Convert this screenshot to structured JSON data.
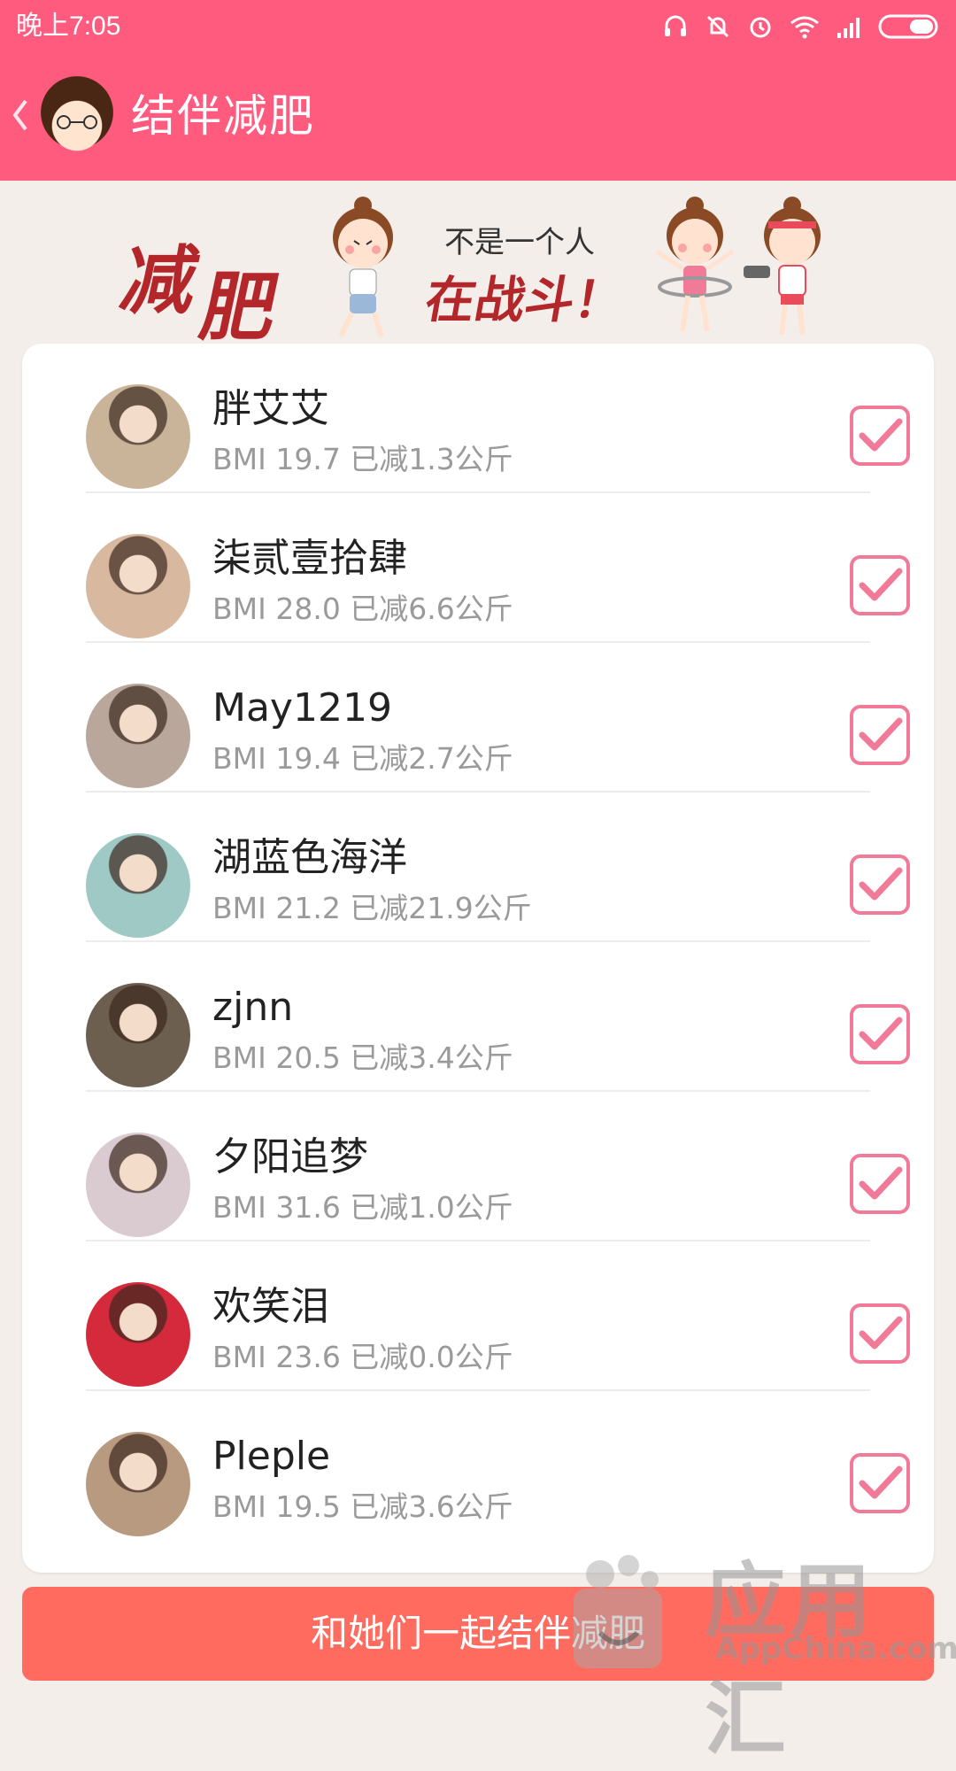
{
  "status_bar": {
    "time": "晚上7:05",
    "icons": [
      "headphones-icon",
      "vibrate-off-icon",
      "alarm-icon",
      "wifi-icon",
      "signal-icon",
      "battery-icon"
    ]
  },
  "app_bar": {
    "title": "结伴减肥",
    "back_icon": "chevron-left-icon"
  },
  "banner": {
    "word1": "减",
    "word2": "肥",
    "line1": "不是一个人",
    "line2": "在战斗！"
  },
  "members": [
    {
      "name": "胖艾艾",
      "stats": "BMI 19.7 已减1.3公斤",
      "checked": true,
      "avatar_color": "#c9b49a"
    },
    {
      "name": "柒贰壹拾肆",
      "stats": "BMI 28.0 已减6.6公斤",
      "checked": true,
      "avatar_color": "#d8b9a0"
    },
    {
      "name": "May1219",
      "stats": "BMI 19.4 已减2.7公斤",
      "checked": true,
      "avatar_color": "#b8a79a"
    },
    {
      "name": "湖蓝色海洋",
      "stats": "BMI 21.2 已减21.9公斤",
      "checked": true,
      "avatar_color": "#9fc9c4"
    },
    {
      "name": "zjnn",
      "stats": "BMI 20.5 已减3.4公斤",
      "checked": true,
      "avatar_color": "#6d5f50"
    },
    {
      "name": "夕阳追梦",
      "stats": "BMI 31.6 已减1.0公斤",
      "checked": true,
      "avatar_color": "#d9cbd0"
    },
    {
      "name": "欢笑泪",
      "stats": "BMI 23.6 已减0.0公斤",
      "checked": true,
      "avatar_color": "#d42a3c"
    },
    {
      "name": "Pleple",
      "stats": "BMI 19.5 已减3.6公斤",
      "checked": true,
      "avatar_color": "#b89a80"
    }
  ],
  "join_button": {
    "label": "和她们一起结伴减肥"
  },
  "watermark": {
    "big": "应用汇",
    "small": "AppChina.com"
  },
  "colors": {
    "primary": "#ff5b7f",
    "checkbox": "#f07a97",
    "button": "#ff6b5f",
    "banner_red": "#b3262a"
  }
}
